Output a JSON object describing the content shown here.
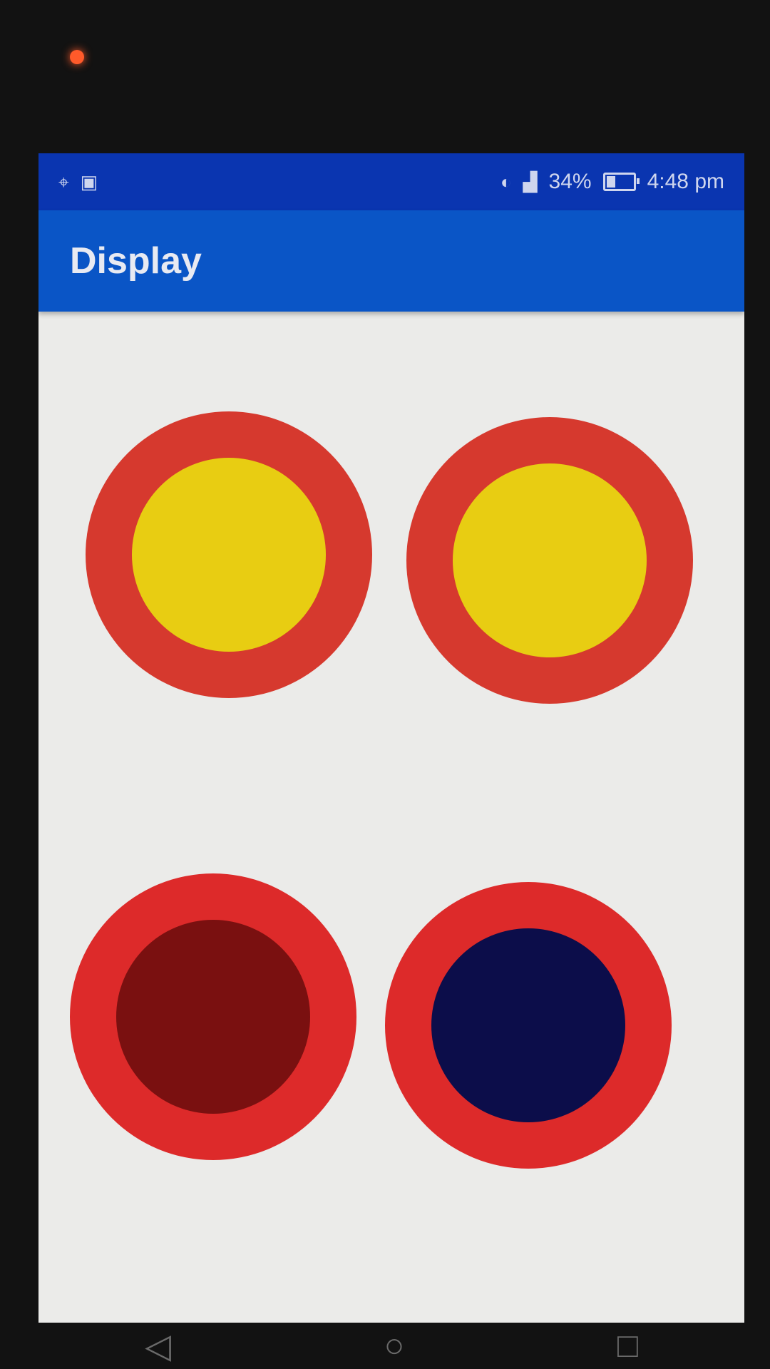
{
  "status_bar": {
    "left_icons": [
      "location-icon",
      "notification-icon"
    ],
    "battery_percent": "34%",
    "battery_level": 0.34,
    "time": "4:48 pm"
  },
  "app_bar": {
    "title": "Display"
  },
  "circles": [
    {
      "id": "top-left",
      "ring_color": "#d6392e",
      "inner_color": "#e8cd12"
    },
    {
      "id": "top-right",
      "ring_color": "#d6392e",
      "inner_color": "#e8cd12"
    },
    {
      "id": "bottom-left",
      "ring_color": "#dd2a2a",
      "inner_color": "#7a1010"
    },
    {
      "id": "bottom-right",
      "ring_color": "#dd2a2a",
      "inner_color": "#0c0d4a"
    }
  ],
  "nav_bar": {
    "back_icon": "triangle-back-icon",
    "home_icon": "circle-home-icon",
    "recents_icon": "square-recents-icon"
  },
  "colors": {
    "status_bar": "#0a35b0",
    "app_bar": "#0a55c6",
    "background": "#ebebe9"
  }
}
